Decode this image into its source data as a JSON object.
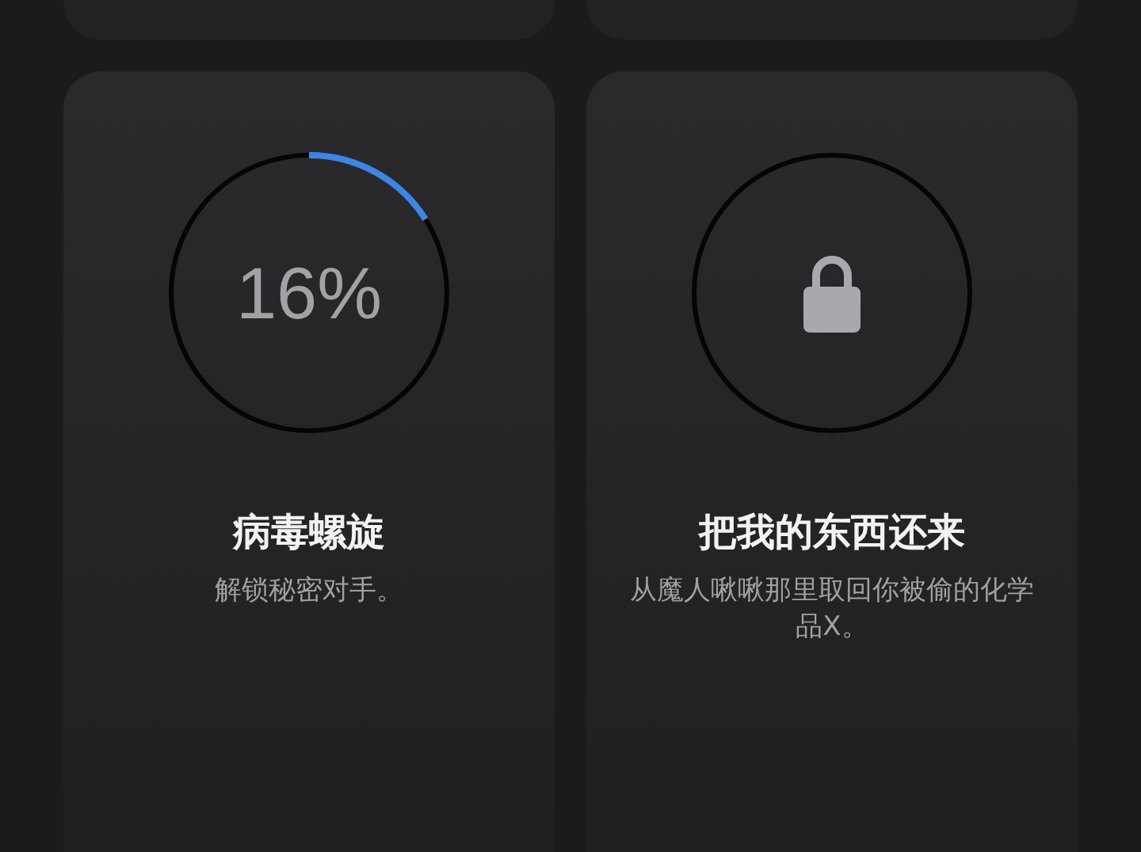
{
  "achievements": [
    {
      "kind": "progress",
      "label": "16%",
      "title": "病毒螺旋",
      "description": "解锁秘密对手。"
    },
    {
      "kind": "locked",
      "title": "把我的东西还来",
      "description": "从魔人啾啾那里取回你被偷的化学品X。"
    }
  ]
}
